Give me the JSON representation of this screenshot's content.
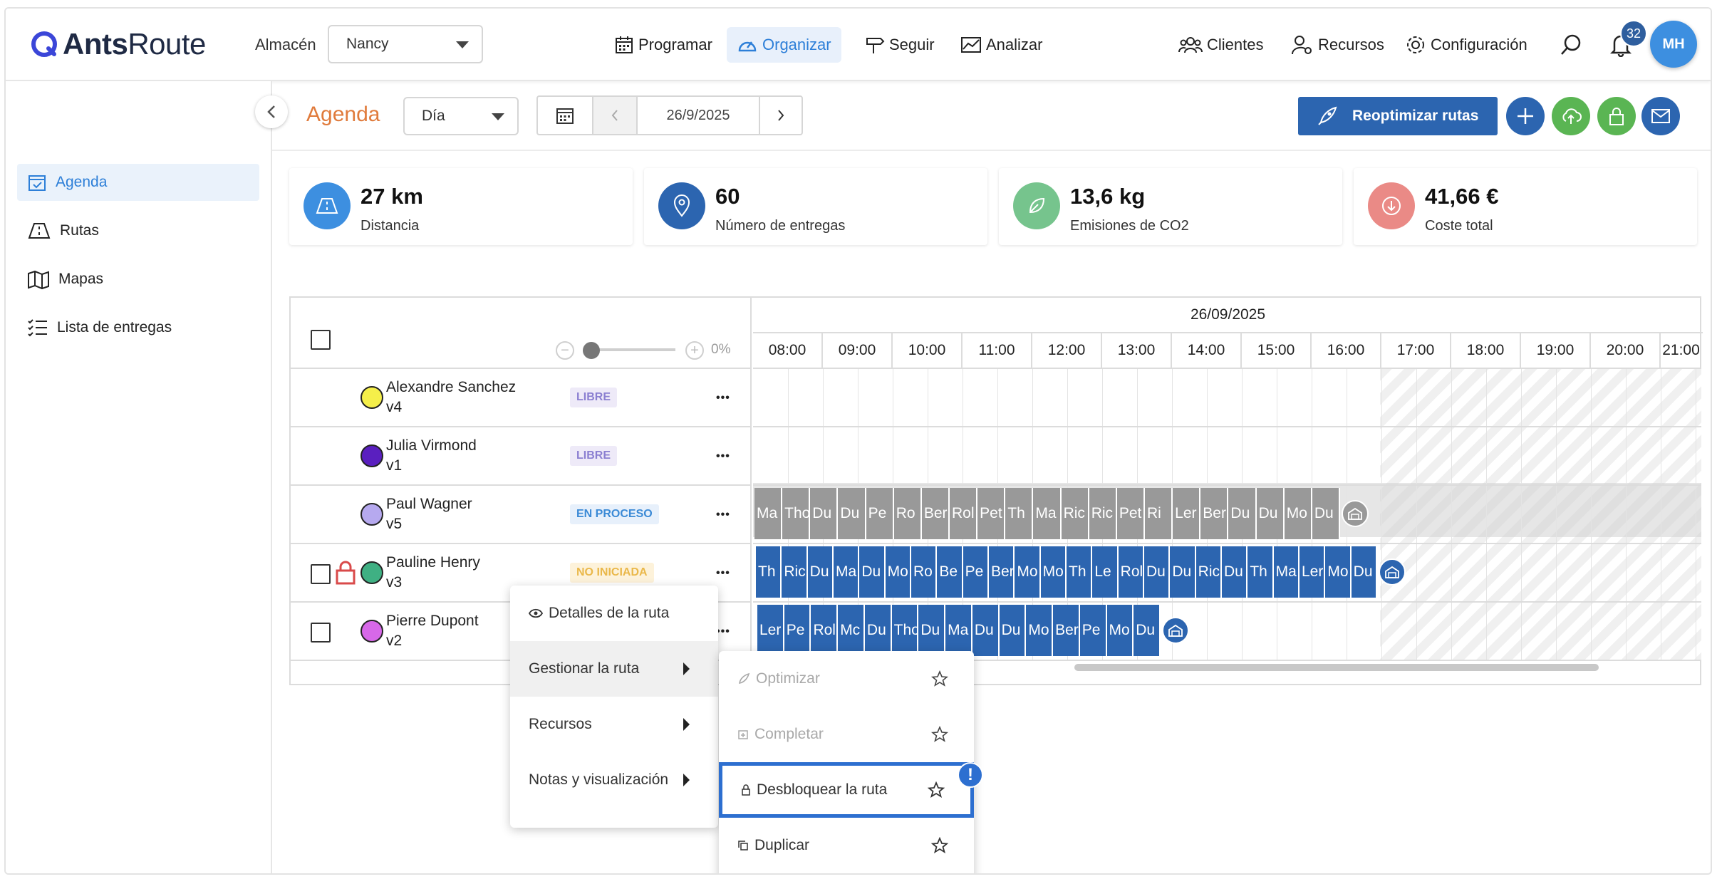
{
  "app": {
    "logo_bold": "Ants",
    "logo_light": "Route"
  },
  "header": {
    "warehouse_label": "Almacén",
    "warehouse_value": "Nancy",
    "nav": {
      "programar": "Programar",
      "organizar": "Organizar",
      "seguir": "Seguir",
      "analizar": "Analizar"
    },
    "right": {
      "clientes": "Clientes",
      "recursos": "Recursos",
      "configuracion": "Configuración"
    },
    "notifications": "32",
    "user_initials": "MH"
  },
  "sidebar": {
    "agenda": "Agenda",
    "rutas": "Rutas",
    "mapas": "Mapas",
    "lista": "Lista de entregas"
  },
  "toolbar": {
    "title": "Agenda",
    "view": "Día",
    "date": "26/9/2025",
    "reoptimize": "Reoptimizar rutas"
  },
  "kpis": {
    "distance": {
      "value": "27 km",
      "label": "Distancia"
    },
    "deliveries": {
      "value": "60",
      "label": "Número de entregas"
    },
    "co2": {
      "value": "13,6 kg",
      "label": "Emisiones de CO2"
    },
    "cost": {
      "value": "41,66 €",
      "label": "Coste total"
    }
  },
  "schedule": {
    "zoom_percent": "0%",
    "date": "26/09/2025",
    "hours": [
      "08:00",
      "09:00",
      "10:00",
      "11:00",
      "12:00",
      "13:00",
      "14:00",
      "15:00",
      "16:00",
      "17:00",
      "18:00",
      "19:00",
      "20:00",
      "21:00"
    ],
    "rows": [
      {
        "name": "Alexandre Sanchez",
        "vehicle": "v4",
        "status": "LIBRE",
        "color": "#f5ef4a"
      },
      {
        "name": "Julia Virmond",
        "vehicle": "v1",
        "status": "LIBRE",
        "color": "#5a1fbf"
      },
      {
        "name": "Paul Wagner",
        "vehicle": "v5",
        "status": "EN PROCESO",
        "color": "#b6a9ef"
      },
      {
        "name": "Pauline Henry",
        "vehicle": "v3",
        "status": "NO INICIADA",
        "color": "#3fb083"
      },
      {
        "name": "Pierre Dupont",
        "vehicle": "v2",
        "status": "",
        "color": "#d768e8"
      }
    ],
    "tasks_paul": [
      "Ma",
      "Tho",
      "Du",
      "Du",
      "Pe",
      "Ro",
      "Ber",
      "Rol",
      "Pet",
      "Th",
      "Ma",
      "Ric",
      "Ric",
      "Pet",
      "Ri",
      "Ler",
      "Ber",
      "Du",
      "Du",
      "Mo",
      "Du"
    ],
    "tasks_pauline": [
      "Th",
      "Ric",
      "Du",
      "Ma",
      "Du",
      "Mo",
      "Ro",
      "Be",
      "Pe",
      "Ber",
      "Mo",
      "Mo",
      "Th",
      "Le",
      "Rol",
      "Du",
      "Du",
      "Ric",
      "Du",
      "Th",
      "Ma",
      "Ler",
      "Mo",
      "Du"
    ],
    "tasks_pierre": [
      "Ler",
      "Pe",
      "Rol",
      "Mc",
      "Du",
      "Tho",
      "Du",
      "Ma",
      "Du",
      "Du",
      "Mo",
      "Ber",
      "Pe",
      "Mo",
      "Du"
    ]
  },
  "context_menu": {
    "details": "Detalles de la ruta",
    "manage": "Gestionar la ruta",
    "resources": "Recursos",
    "notes": "Notas y visualización"
  },
  "submenu": {
    "optimize": "Optimizar",
    "complete": "Completar",
    "unlock": "Desbloquear la ruta",
    "duplicate": "Duplicar"
  }
}
